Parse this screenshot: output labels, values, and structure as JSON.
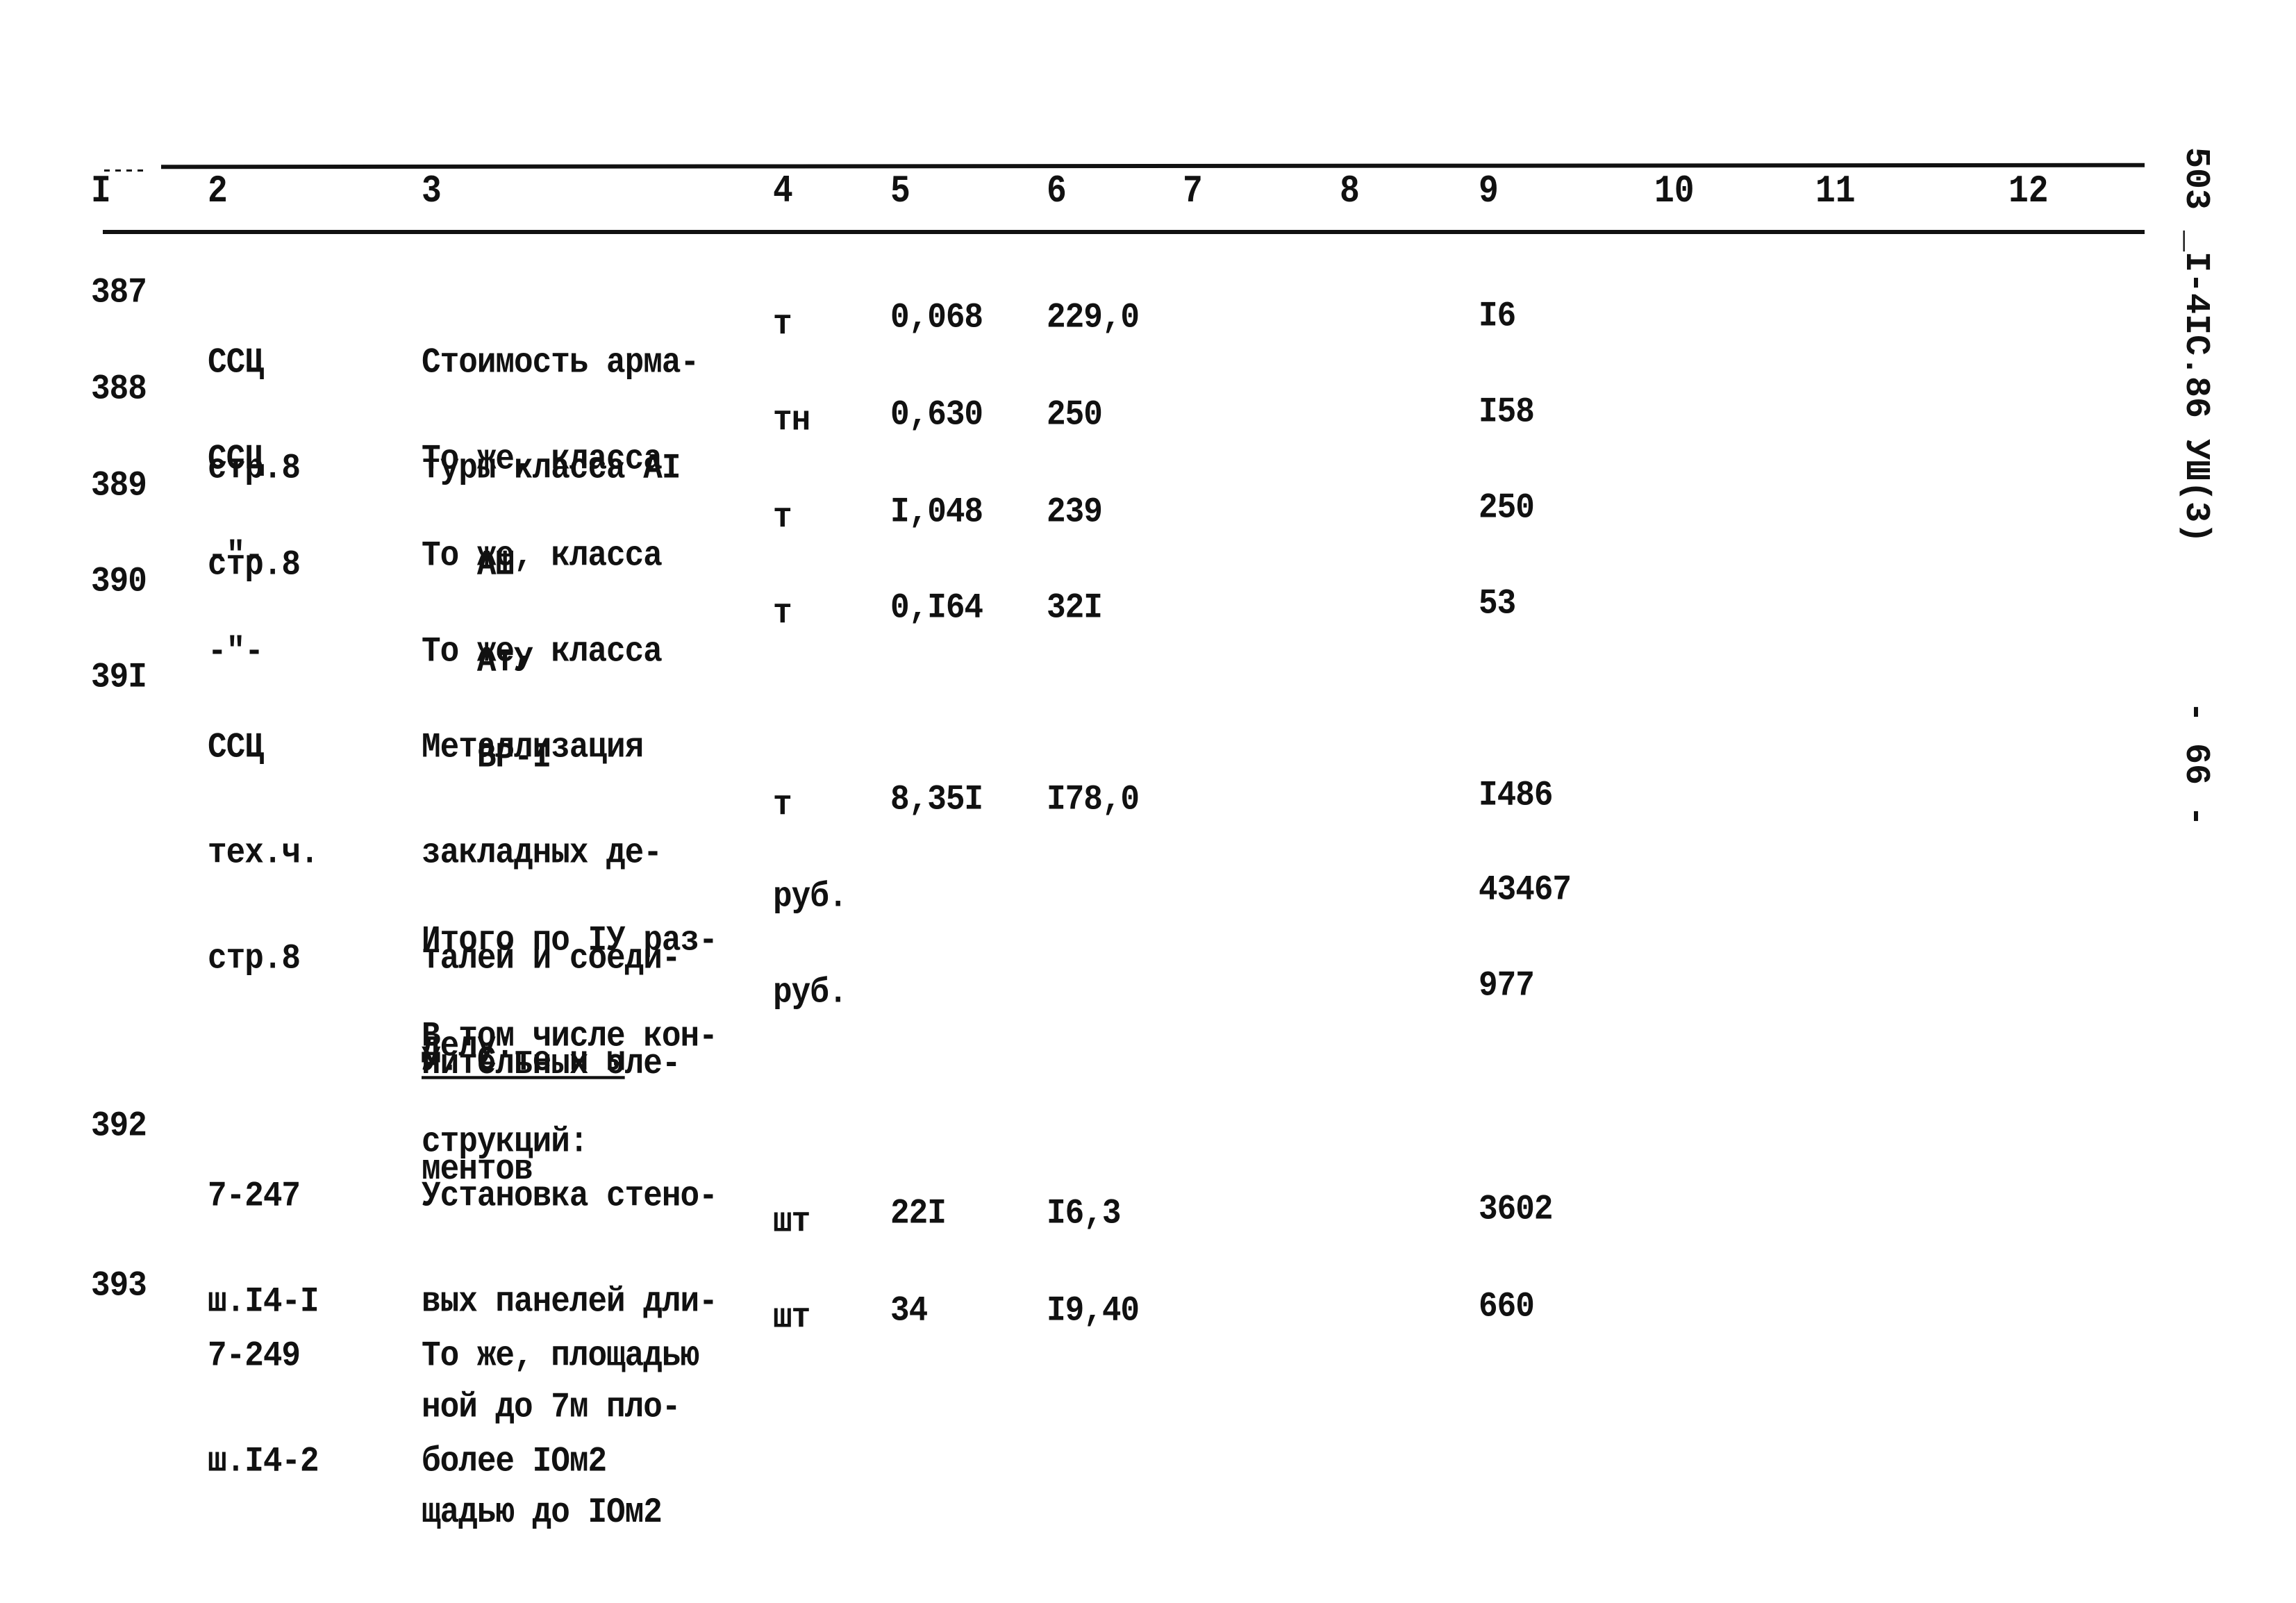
{
  "document": {
    "side_code": "503 _I-4IC.86 УШ(3)",
    "page_number": "- 66 -"
  },
  "header": {
    "columns": [
      "I",
      "2",
      "3",
      "4",
      "5",
      "6",
      "7",
      "8",
      "9",
      "10",
      "11",
      "12"
    ]
  },
  "rows": [
    {
      "num": "387",
      "ref": [
        "ССЦ",
        "стр.8"
      ],
      "desc": [
        "Стоимость арма-",
        "туры класса AI"
      ],
      "unit": "т",
      "qty": "0,068",
      "price": "229,0",
      "total": "I6"
    },
    {
      "num": "388",
      "ref": [
        "ССЦ",
        "стр.8"
      ],
      "desc": [
        "То же, класса",
        "   AШ"
      ],
      "unit": "тн",
      "qty": "0,630",
      "price": "250",
      "total": "I58"
    },
    {
      "num": "389",
      "ref": [
        "-\"-"
      ],
      "desc": [
        "То же, класса",
        "   АтУ"
      ],
      "unit": "т",
      "qty": "I,048",
      "price": "239",
      "total": "250"
    },
    {
      "num": "390",
      "ref": [
        "-\"-"
      ],
      "desc": [
        "То же, класса",
        "   ВР-I"
      ],
      "unit": "т",
      "qty": "0,I64",
      "price": "32I",
      "total": "53"
    },
    {
      "num": "39I",
      "ref": [
        "ССЦ",
        "тех.ч.",
        "стр.8"
      ],
      "desc": [
        "Металлизация",
        "закладных де-",
        "талей и соеди-",
        "нительных эле-",
        "ментов"
      ],
      "unit": "т",
      "qty": "8,35I",
      "price": "I78,0",
      "total": "I486"
    }
  ],
  "summary": [
    {
      "desc": [
        "Итого по IУ раз-",
        "делу:"
      ],
      "unit": "руб.",
      "total": "43467"
    },
    {
      "desc": [
        "В том числе кон-",
        "струкций:"
      ],
      "unit": "руб.",
      "total": "977"
    }
  ],
  "section_title": "У. С те н ы",
  "rows2": [
    {
      "num": "392",
      "ref": [
        "7-247",
        "ш.I4-I"
      ],
      "desc": [
        "Установка стено-",
        "вых панелей дли-",
        "ной до 7м пло-",
        "щадью до IОм2"
      ],
      "unit": "шт",
      "qty": "22I",
      "price": "I6,3",
      "total": "3602"
    },
    {
      "num": "393",
      "ref": [
        "7-249",
        "ш.I4-2"
      ],
      "desc": [
        "То же, площадью",
        "более IОм2"
      ],
      "unit": "шт",
      "qty": "34",
      "price": "I9,40",
      "total": "660"
    }
  ]
}
